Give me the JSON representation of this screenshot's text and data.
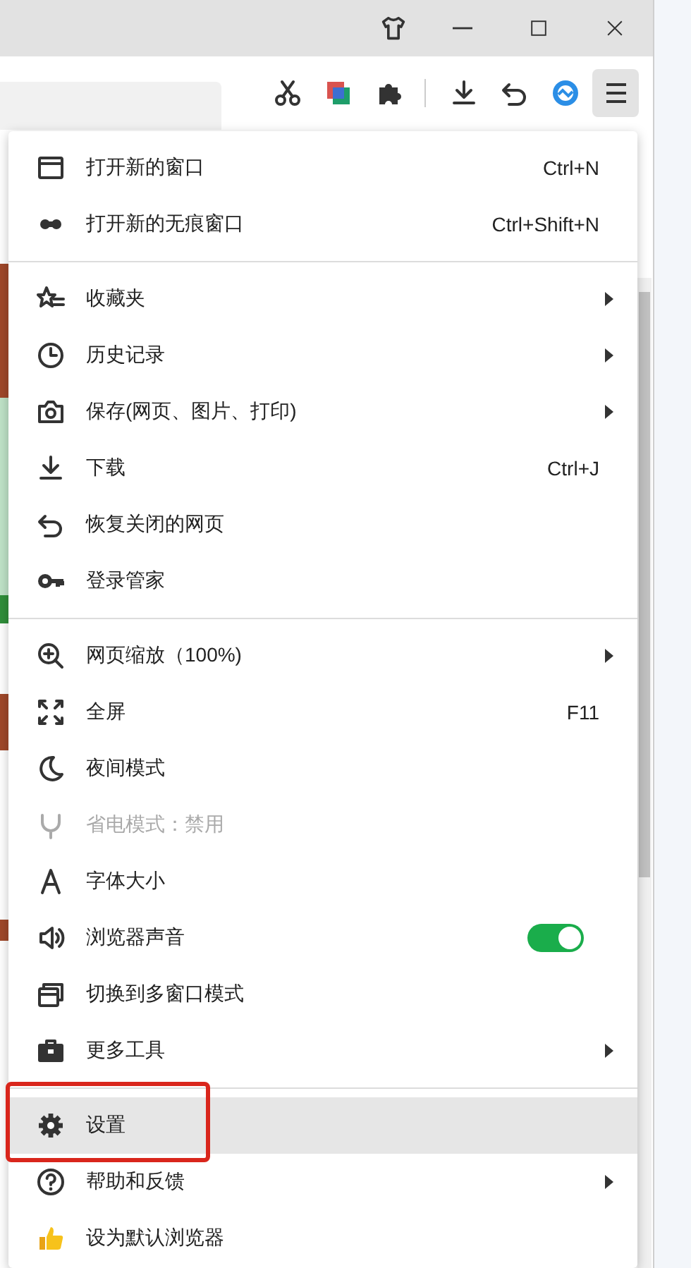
{
  "menu": {
    "groups": [
      {
        "items": [
          {
            "kind": "item",
            "label": "打开新的窗口",
            "shortcut": "Ctrl+N",
            "submenu": false,
            "disabled": false,
            "highlighted": false,
            "marked": false
          },
          {
            "kind": "item",
            "label": "打开新的无痕窗口",
            "shortcut": "Ctrl+Shift+N",
            "submenu": false,
            "disabled": false,
            "highlighted": false,
            "marked": false
          }
        ]
      },
      {
        "items": [
          {
            "kind": "item",
            "label": "收藏夹",
            "submenu": true,
            "disabled": false,
            "highlighted": false,
            "marked": false
          },
          {
            "kind": "item",
            "label": "历史记录",
            "submenu": true,
            "disabled": false,
            "highlighted": false,
            "marked": false
          },
          {
            "kind": "item",
            "label": "保存(网页、图片、打印)",
            "submenu": true,
            "disabled": false,
            "highlighted": false,
            "marked": false
          },
          {
            "kind": "item",
            "label": "下载",
            "shortcut": "Ctrl+J",
            "submenu": false,
            "disabled": false,
            "highlighted": false,
            "marked": false
          },
          {
            "kind": "item",
            "label": "恢复关闭的网页",
            "submenu": false,
            "disabled": false,
            "highlighted": false,
            "marked": false
          },
          {
            "kind": "item",
            "label": "登录管家",
            "submenu": false,
            "disabled": false,
            "highlighted": false,
            "marked": false
          }
        ]
      },
      {
        "items": [
          {
            "kind": "item",
            "label": "网页缩放（100%)",
            "submenu": true,
            "disabled": false,
            "highlighted": false,
            "marked": false
          },
          {
            "kind": "item",
            "label": "全屏",
            "shortcut": "F11",
            "submenu": false,
            "disabled": false,
            "highlighted": false,
            "marked": false
          },
          {
            "kind": "item",
            "label": "夜间模式",
            "submenu": false,
            "disabled": false,
            "highlighted": false,
            "marked": false
          },
          {
            "kind": "item",
            "label": "省电模式：禁用",
            "submenu": false,
            "disabled": true,
            "highlighted": false,
            "marked": false
          },
          {
            "kind": "item",
            "label": "字体大小",
            "submenu": false,
            "disabled": false,
            "highlighted": false,
            "marked": false
          },
          {
            "kind": "toggle",
            "label": "浏览器声音",
            "on": true,
            "submenu": false,
            "disabled": false,
            "highlighted": false,
            "marked": false
          },
          {
            "kind": "item",
            "label": "切换到多窗口模式",
            "submenu": false,
            "disabled": false,
            "highlighted": false,
            "marked": false
          },
          {
            "kind": "item",
            "label": "更多工具",
            "submenu": true,
            "disabled": false,
            "highlighted": false,
            "marked": false
          }
        ]
      },
      {
        "items": [
          {
            "kind": "item",
            "label": "设置",
            "submenu": false,
            "disabled": false,
            "highlighted": true,
            "marked": true
          },
          {
            "kind": "item",
            "label": "帮助和反馈",
            "submenu": true,
            "disabled": false,
            "highlighted": false,
            "marked": false
          },
          {
            "kind": "item",
            "label": "设为默认浏览器",
            "submenu": false,
            "disabled": false,
            "highlighted": false,
            "marked": false
          }
        ]
      }
    ]
  }
}
